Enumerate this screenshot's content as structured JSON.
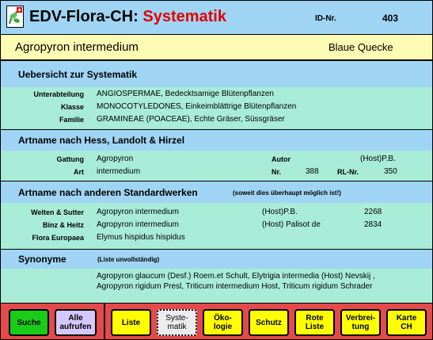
{
  "header": {
    "app_name": "EDV-Flora-CH:",
    "section": "Systematik",
    "id_label": "ID-Nr.",
    "id_value": "403"
  },
  "species": {
    "name": "Agropyron intermedium",
    "common_name": "Blaue Quecke"
  },
  "overview": {
    "heading": "Uebersicht zur Systematik",
    "rows": [
      {
        "label": "Unterabteilung",
        "value": "ANGIOSPERMAE, Bedecktsamige Blütenpflanzen"
      },
      {
        "label": "Klasse",
        "value": "MONOCOTYLEDONES, Einkeimblättrige Blütenpflanzen"
      },
      {
        "label": "Familie",
        "value": "GRAMINEAE (POACEAE), Echte Gräser, Süssgräser"
      }
    ]
  },
  "hess": {
    "heading": "Artname nach Hess, Landolt & Hirzel",
    "gattung_label": "Gattung",
    "gattung_value": "Agropyron",
    "art_label": "Art",
    "art_value": "intermedium",
    "autor_label": "Autor",
    "autor_value": "(Host)P.B.",
    "nr_label": "Nr.",
    "nr_value": "388",
    "rl_label": "RL-Nr.",
    "rl_value": "350"
  },
  "standard": {
    "heading": "Artname nach anderen Standardwerken",
    "note": "(soweit dies überhaupt möglich ist!)",
    "rows": [
      {
        "label": "Welten & Sutter",
        "name": "Agropyron intermedium",
        "author": "(Host)P.B.",
        "number": "2268"
      },
      {
        "label": "Binz & Heitz",
        "name": "Agropyron intermedium",
        "author": "(Host) Palisot de",
        "number": "2834"
      },
      {
        "label": "Flora Europaea",
        "name": "Elymus hispidus hispidus",
        "author": "",
        "number": ""
      }
    ]
  },
  "synonyme": {
    "heading": "Synonyme",
    "note": "(Liste unvollständig)",
    "line1": "Agropyron glaucum (Desf.) Roem.et Schult, Elytrigia intermedia (Host) Nevskij ,",
    "line2": "Agropyron rigidum Presl, Triticum intermedium Host, Triticum rigidum Schrader"
  },
  "toolbar": {
    "suche": "Suche",
    "alle": "Alle\naufrufen",
    "liste": "Liste",
    "systematik": "Syste-\nmatik",
    "oekologie": "Öko-\nlogie",
    "schutz": "Schutz",
    "rote_liste": "Rote\nListe",
    "verbreitung": "Verbrei-\ntung",
    "karte": "Karte\nCH"
  },
  "colors": {
    "accent_red": "#e00000",
    "header_blue": "#9fd4f4",
    "body_mint": "#a8ecd8",
    "species_yellow": "#fdfbb4",
    "toolbar_red": "#e44a4a"
  }
}
